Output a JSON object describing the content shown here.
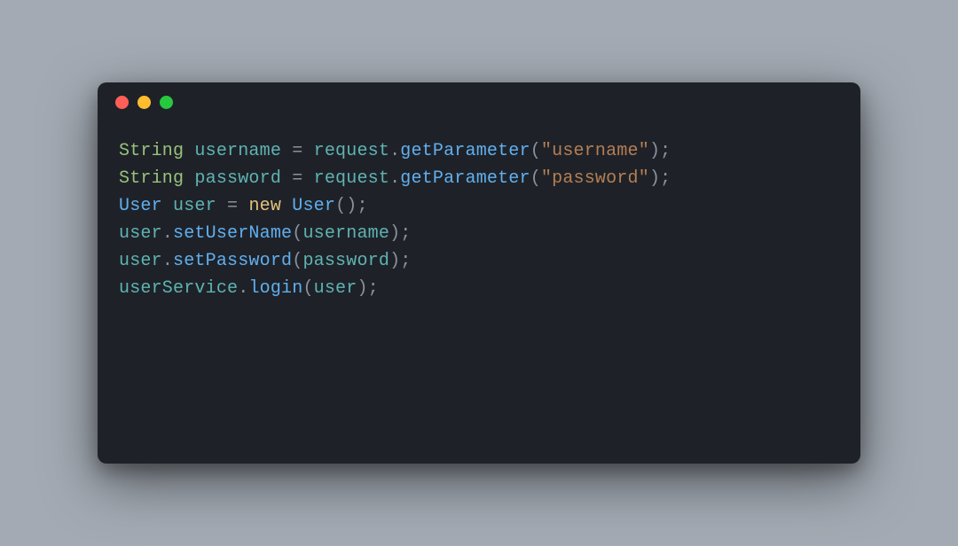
{
  "window": {
    "traffic_lights": {
      "close": "close",
      "minimize": "minimize",
      "zoom": "zoom"
    }
  },
  "code": {
    "language": "java",
    "colors": {
      "type": "#99c27c",
      "keyword": "#e5c07b",
      "identifier": "#5fb3b3",
      "method": "#61afef",
      "string": "#b57e54",
      "punctuation": "#8a919c",
      "background": "#1e2228"
    },
    "lines": [
      [
        {
          "t": "type",
          "v": "String"
        },
        {
          "t": "sp",
          "v": " "
        },
        {
          "t": "ident",
          "v": "username"
        },
        {
          "t": "sp",
          "v": " "
        },
        {
          "t": "equals",
          "v": "="
        },
        {
          "t": "sp",
          "v": " "
        },
        {
          "t": "ident",
          "v": "request"
        },
        {
          "t": "punct",
          "v": "."
        },
        {
          "t": "method",
          "v": "getParameter"
        },
        {
          "t": "punct",
          "v": "("
        },
        {
          "t": "string",
          "v": "\"username\""
        },
        {
          "t": "punct",
          "v": ");"
        }
      ],
      [
        {
          "t": "type",
          "v": "String"
        },
        {
          "t": "sp",
          "v": " "
        },
        {
          "t": "ident",
          "v": "password"
        },
        {
          "t": "sp",
          "v": " "
        },
        {
          "t": "equals",
          "v": "="
        },
        {
          "t": "sp",
          "v": " "
        },
        {
          "t": "ident",
          "v": "request"
        },
        {
          "t": "punct",
          "v": "."
        },
        {
          "t": "method",
          "v": "getParameter"
        },
        {
          "t": "punct",
          "v": "("
        },
        {
          "t": "string",
          "v": "\"password\""
        },
        {
          "t": "punct",
          "v": ");"
        }
      ],
      [
        {
          "t": "method",
          "v": "User"
        },
        {
          "t": "sp",
          "v": " "
        },
        {
          "t": "ident",
          "v": "user"
        },
        {
          "t": "sp",
          "v": " "
        },
        {
          "t": "equals",
          "v": "="
        },
        {
          "t": "sp",
          "v": " "
        },
        {
          "t": "keyword",
          "v": "new"
        },
        {
          "t": "sp",
          "v": " "
        },
        {
          "t": "method",
          "v": "User"
        },
        {
          "t": "punct",
          "v": "();"
        }
      ],
      [
        {
          "t": "ident",
          "v": "user"
        },
        {
          "t": "punct",
          "v": "."
        },
        {
          "t": "method",
          "v": "setUserName"
        },
        {
          "t": "punct",
          "v": "("
        },
        {
          "t": "ident",
          "v": "username"
        },
        {
          "t": "punct",
          "v": ");"
        }
      ],
      [
        {
          "t": "ident",
          "v": "user"
        },
        {
          "t": "punct",
          "v": "."
        },
        {
          "t": "method",
          "v": "setPassword"
        },
        {
          "t": "punct",
          "v": "("
        },
        {
          "t": "ident",
          "v": "password"
        },
        {
          "t": "punct",
          "v": ");"
        }
      ],
      [
        {
          "t": "ident",
          "v": "userService"
        },
        {
          "t": "punct",
          "v": "."
        },
        {
          "t": "method",
          "v": "login"
        },
        {
          "t": "punct",
          "v": "("
        },
        {
          "t": "ident",
          "v": "user"
        },
        {
          "t": "punct",
          "v": ");"
        }
      ]
    ]
  }
}
